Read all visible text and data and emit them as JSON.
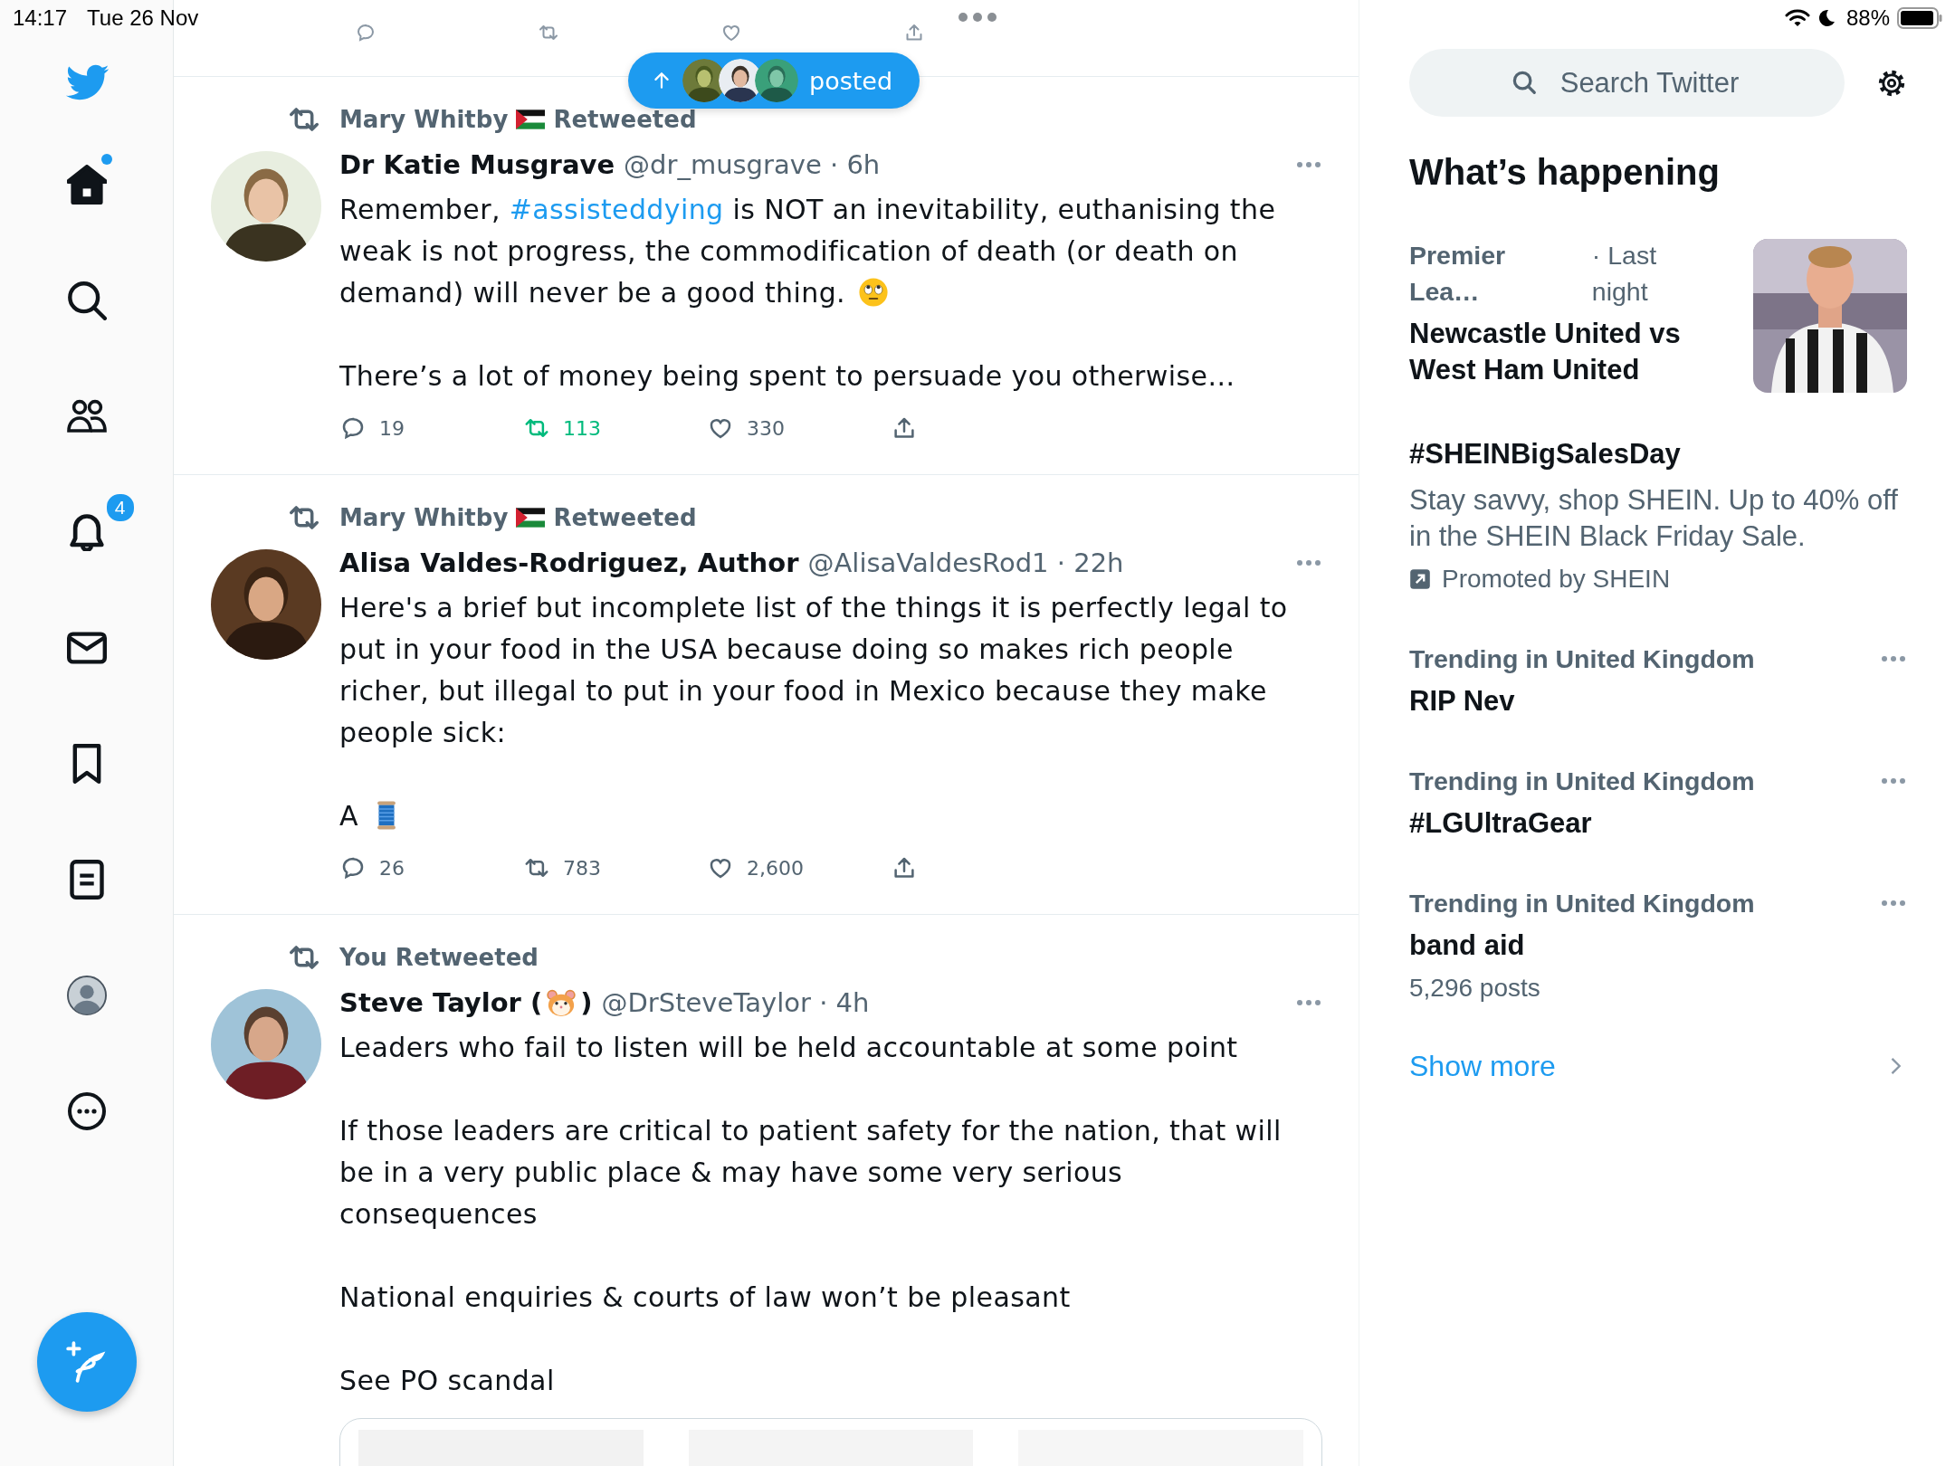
{
  "status_bar": {
    "time": "14:17",
    "date": "Tue 26 Nov",
    "battery": "88%"
  },
  "sidebar": {
    "items": [
      {
        "kind": "home",
        "selected": true,
        "unread": true
      },
      {
        "kind": "explore",
        "selected": false,
        "unread": false
      },
      {
        "kind": "communities",
        "selected": false,
        "unread": false
      },
      {
        "kind": "notifications",
        "selected": false,
        "unread": false,
        "badge": "4"
      },
      {
        "kind": "messages",
        "selected": false,
        "unread": false
      },
      {
        "kind": "bookmarks",
        "selected": false,
        "unread": false
      },
      {
        "kind": "lists",
        "selected": false,
        "unread": false
      },
      {
        "kind": "profile",
        "selected": false,
        "unread": false
      },
      {
        "kind": "more",
        "selected": false,
        "unread": false
      }
    ]
  },
  "posted_pill": {
    "label": "posted",
    "avatars": [
      {
        "kind": "picture"
      },
      {
        "kind": "picture"
      },
      {
        "kind": "picture"
      }
    ]
  },
  "tweets": [
    {
      "retweet_label": [
        {
          "kind": "text",
          "text": "Mary Whitby "
        },
        {
          "kind": "flag"
        },
        {
          "kind": "text",
          "text": " Retweeted"
        }
      ],
      "avatar": {
        "kind": "picture"
      },
      "name": [
        {
          "kind": "text",
          "text": "Dr Katie Musgrave"
        }
      ],
      "meta": "@dr_musgrave · 6h",
      "body": [
        [
          {
            "kind": "text",
            "text": "Remember, "
          },
          {
            "kind": "link",
            "text": "#assisteddying"
          },
          {
            "kind": "text",
            "text": " is NOT an inevitability, euthanising the weak is not progress, the commodification of death (or death on demand) will never be a good thing. "
          },
          {
            "kind": "eyeroll"
          }
        ],
        [
          {
            "kind": "text",
            "text": "There’s a lot of money being spent to persuade you otherwise…"
          }
        ]
      ],
      "stats": {
        "replies": "19",
        "retweets": "113",
        "likes": "330"
      },
      "retweeted": true,
      "liked": false
    },
    {
      "retweet_label": [
        {
          "kind": "text",
          "text": "Mary Whitby "
        },
        {
          "kind": "flag"
        },
        {
          "kind": "text",
          "text": " Retweeted"
        }
      ],
      "avatar": {
        "kind": "picture"
      },
      "name": [
        {
          "kind": "text",
          "text": "Alisa Valdes-Rodriguez, Author"
        }
      ],
      "meta": "@AlisaValdesRod1 · 22h",
      "body": [
        [
          {
            "kind": "text",
            "text": "Here's a brief but incomplete list of the things it is perfectly legal to put in your food in the USA because doing so makes rich people richer, but illegal to put in your food in Mexico because they make people sick:"
          }
        ],
        [
          {
            "kind": "text",
            "text": "A "
          },
          {
            "kind": "spool"
          }
        ]
      ],
      "stats": {
        "replies": "26",
        "retweets": "783",
        "likes": "2,600"
      },
      "retweeted": false,
      "liked": false
    },
    {
      "retweet_label": [
        {
          "kind": "text",
          "text": "You Retweeted"
        }
      ],
      "avatar": {
        "kind": "picture"
      },
      "name": [
        {
          "kind": "text",
          "text": "Steve Taylor ("
        },
        {
          "kind": "hamster"
        },
        {
          "kind": "text",
          "text": ")"
        }
      ],
      "meta": "@DrSteveTaylor · 4h",
      "body": [
        [
          {
            "kind": "text",
            "text": "Leaders who fail to listen will be held accountable at some point"
          }
        ],
        [
          {
            "kind": "text",
            "text": "If those leaders are critical to patient safety for the nation, that will be in a very public place & may have some very serious consequences"
          }
        ],
        [
          {
            "kind": "text",
            "text": "National enquiries & courts of law won’t be pleasant"
          }
        ],
        [
          {
            "kind": "text",
            "text": "See PO scandal"
          }
        ]
      ],
      "media": [
        {
          "kind": "picture"
        },
        {
          "kind": "picture"
        },
        {
          "kind": "picture"
        }
      ]
    }
  ],
  "search": {
    "placeholder": "Search Twitter"
  },
  "trends_title": "What’s happening",
  "trends": [
    {
      "kind": "event",
      "category": "Premier Lea…",
      "time": "· Last night",
      "title": "Newcastle United vs West Ham United",
      "image": {
        "kind": "picture"
      }
    },
    {
      "kind": "promoted",
      "title": "#SHEINBigSalesDay",
      "description": "Stay savvy, shop SHEIN. Up to 40% off in the SHEIN Black Friday Sale.",
      "promoted_by": "Promoted by SHEIN"
    },
    {
      "kind": "trend",
      "category": "Trending in United Kingdom",
      "title": "RIP Nev"
    },
    {
      "kind": "trend",
      "category": "Trending in United Kingdom",
      "title": "#LGUltraGear"
    },
    {
      "kind": "trend",
      "category": "Trending in United Kingdom",
      "title": "band aid",
      "posts": "5,296 posts"
    }
  ],
  "show_more": "Show more"
}
